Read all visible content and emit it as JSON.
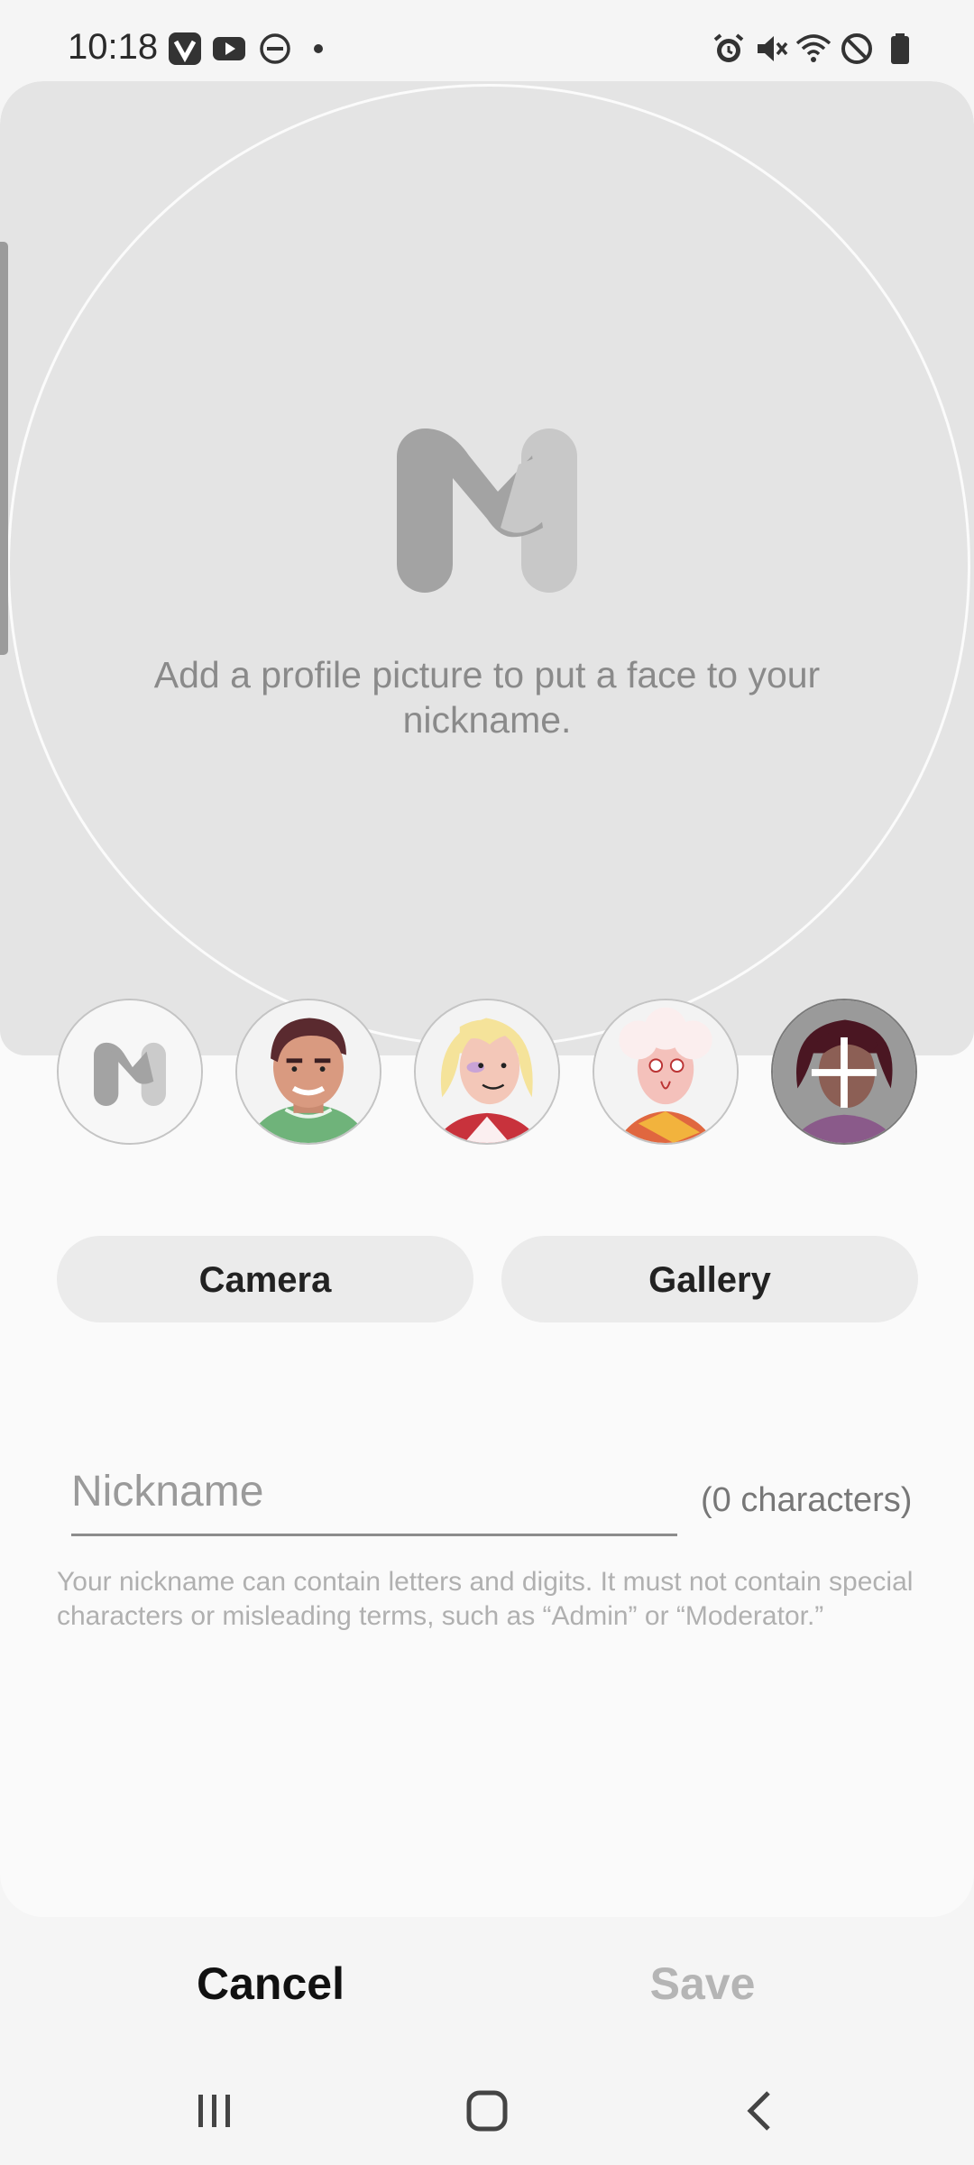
{
  "status_bar": {
    "time": "10:18",
    "left_icons": [
      "vivaldi-icon",
      "youtube-icon",
      "dnd-icon",
      "dot-icon"
    ],
    "right_icons": [
      "alarm-icon",
      "mute-icon",
      "wifi-icon",
      "blocked-icon",
      "battery-icon"
    ]
  },
  "hero": {
    "message": "Add a profile picture to put a face to your nickname."
  },
  "avatars": [
    "default-m-avatar",
    "man-avatar",
    "blonde-woman-avatar",
    "elderly-woman-avatar",
    "woman-avatar-selected"
  ],
  "buttons": {
    "camera": "Camera",
    "gallery": "Gallery"
  },
  "nickname": {
    "placeholder": "Nickname",
    "value": "",
    "char_count": "(0 characters)",
    "hint": "Your nickname can contain letters and digits. It must not contain special characters or misleading terms, such as “Admin” or “Moderator.”"
  },
  "actions": {
    "cancel": "Cancel",
    "save": "Save"
  },
  "colors": {
    "hero_bg": "#e4e4e4",
    "sheet_bg": "#fafafa",
    "save_disabled": "#b5b5b5"
  }
}
